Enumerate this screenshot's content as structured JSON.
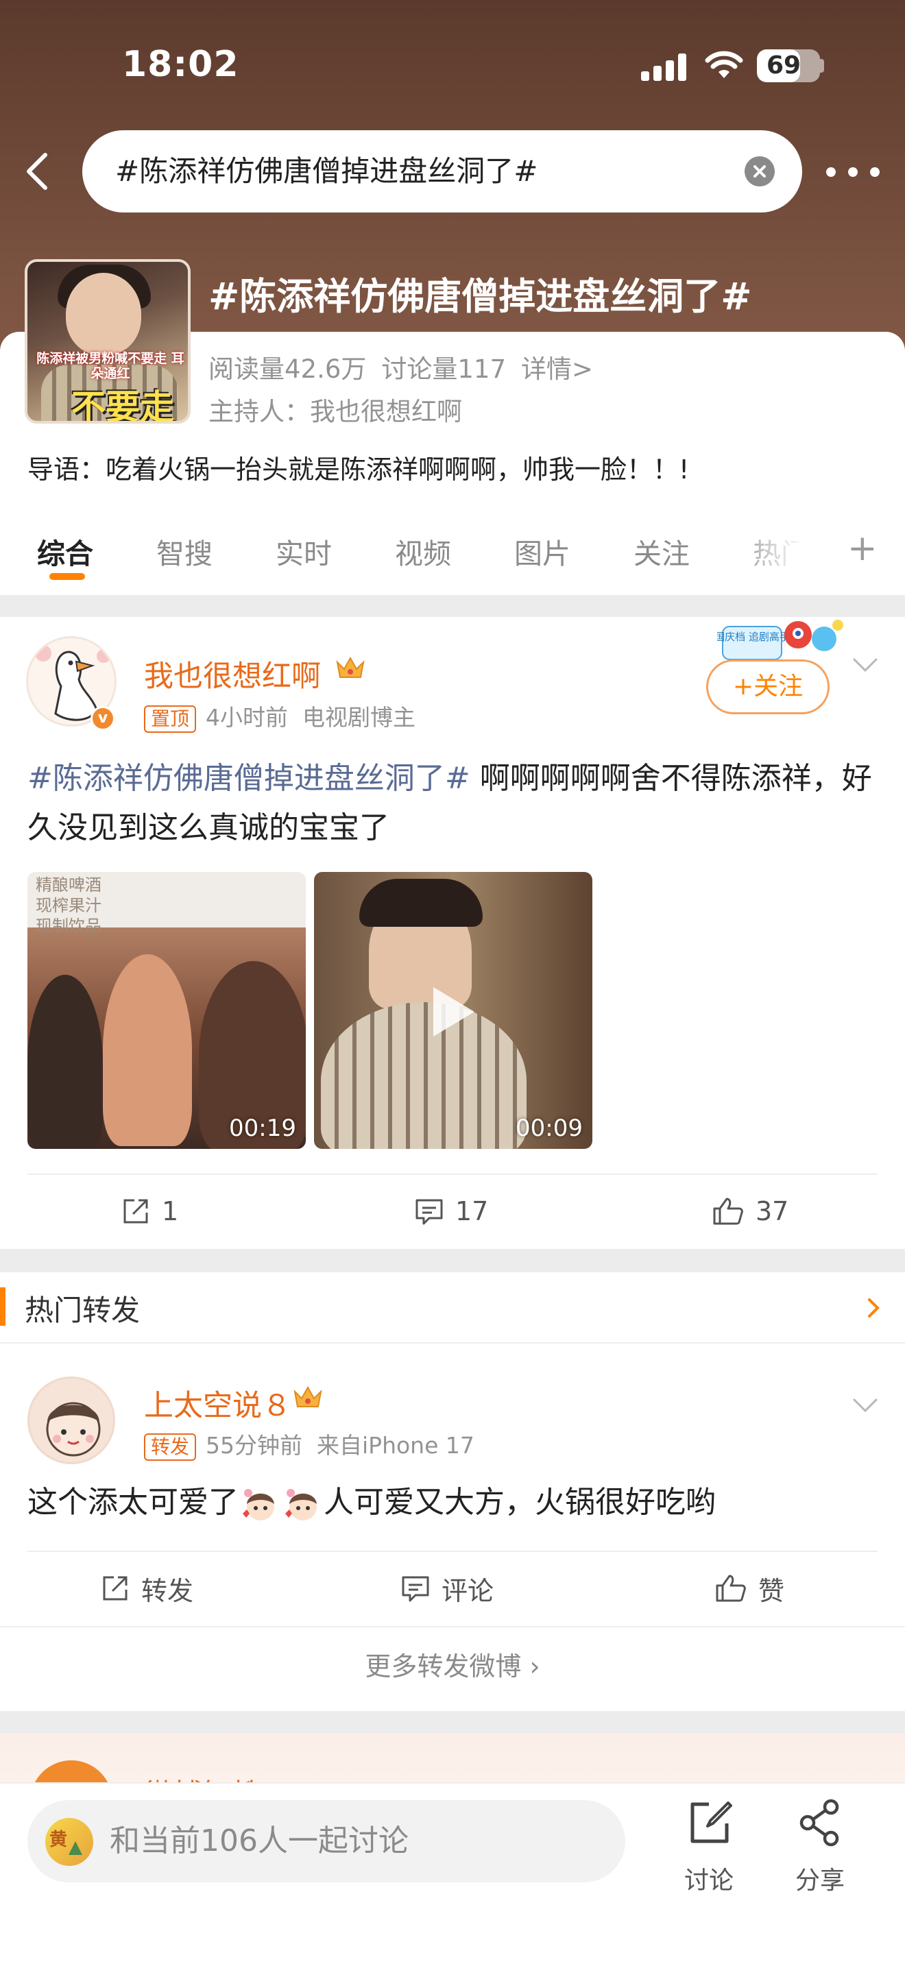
{
  "status_bar": {
    "time": "18:02",
    "battery": "69",
    "battery_level": 0.69
  },
  "search": {
    "query": "#陈添祥仿佛唐僧掉进盘丝洞了#"
  },
  "topic": {
    "cover_caption": "陈添祥被男粉喊不要走 耳朵通红",
    "cover_big_text": "不要走",
    "title": "#陈添祥仿佛唐僧掉进盘丝洞了#",
    "reads": "阅读量42.6万",
    "discussions": "讨论量117",
    "details": "详情>",
    "host": "主持人：我也很想红啊",
    "intro": "导语：吃着火锅一抬头就是陈添祥啊啊啊，帅我一脸！！!"
  },
  "tabs": [
    "综合",
    "智搜",
    "实时",
    "视频",
    "图片",
    "关注",
    "热门"
  ],
  "post": {
    "username": "我也很想红啊",
    "tag": "置顶",
    "time": "4小时前",
    "role": "电视剧博主",
    "follow_label": "+关注",
    "badge_text": "国庆档 追剧高手",
    "hashtag": "#陈添祥仿佛唐僧掉进盘丝洞了#",
    "text": " 啊啊啊啊啊舍不得陈添祥，好久没见到这么真诚的宝宝了",
    "videos": [
      {
        "sign": "精酿啤酒\n现榨果汁\n现制饮品",
        "duration": "00:19"
      },
      {
        "duration": "00:09"
      }
    ],
    "reposts": "1",
    "comments": "17",
    "likes": "37"
  },
  "hot_reposts": {
    "title": "热门转发",
    "username": "上太空说８",
    "tag": "转发",
    "time": "55分钟前",
    "source": "来自iPhone 17",
    "text_before": "这个添太可爱了",
    "text_after": "人可爱又大方，火锅很好吃哟",
    "repost_label": "转发",
    "comment_label": "评论",
    "like_label": "赞",
    "more_label": "更多转发微博 ›"
  },
  "next_card": {
    "username": "微博智搜"
  },
  "bottom_bar": {
    "avatar_text": "黄",
    "placeholder": "和当前106人一起讨论",
    "discuss_label": "讨论",
    "share_label": "分享"
  },
  "colors": {
    "accent": "#ff8200",
    "username": "#e86a1a",
    "hashtag": "#5a6b94"
  }
}
